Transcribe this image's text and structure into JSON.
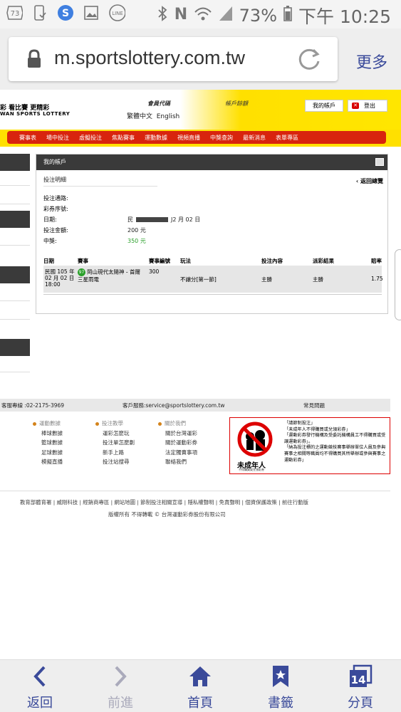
{
  "status_bar": {
    "badge": "73",
    "battery": "73%",
    "time": "下午 10:25"
  },
  "browser": {
    "url": "m.sportslottery.com.tw",
    "more_label": "更多"
  },
  "site_header": {
    "logo_zh": "彩  看比賽  更精彩",
    "logo_en": "WAN SPORTS LOTTERY",
    "member_code": "會員代碼",
    "account_pwd": "帳戶餘額",
    "lang_zh": "繁體中文",
    "lang_en": "English",
    "my_account": "我的帳戶",
    "logout": "登出"
  },
  "nav": [
    "賽事表",
    "場中投注",
    "虛擬投注",
    "焦點賽事",
    "運動數據",
    "視頻直播",
    "中獎查詢",
    "最新消息",
    "表單專區"
  ],
  "panel": {
    "title": "我的帳戶",
    "section": "投注明細",
    "back": "‹ 返回總覽",
    "fields": [
      {
        "label": "投注通路:",
        "value": ""
      },
      {
        "label": "彩券序號:",
        "value": ""
      },
      {
        "label": "日期:",
        "value_prefix": "民",
        "value": "J2 月 02 日"
      },
      {
        "label": "投注金額:",
        "value": "200 元"
      },
      {
        "label": "中獎:",
        "value": "350 元"
      }
    ],
    "headers": [
      "日期",
      "賽事",
      "賽事編號",
      "玩法",
      "投注內容",
      "派彩結果",
      "賠率"
    ],
    "row": {
      "date1": "民國 105 年",
      "date2": "02 月 02 日",
      "date3": "18:00",
      "badge": "97",
      "match1": "岡山現代太陽神 - 首爾",
      "match2": "三星雨電",
      "match_no": "300",
      "play": "不讓分[第一節]",
      "content": "主勝",
      "result": "主勝",
      "odds": "1.75"
    }
  },
  "footer": {
    "hotline": "客服專線 :02-2175-3969",
    "service": "客戶服務:service@sportslottery.com.tw",
    "faq": "常見問題",
    "col1_head": "運動數據",
    "col1": [
      "棒球數據",
      "籃球數據",
      "足球數據",
      "模擬直播"
    ],
    "col2_head": "投注教學",
    "col2": [
      "運彩怎麼玩",
      "投注單怎麼劃",
      "新手上路",
      "投注站搜尋"
    ],
    "col3_head": "關於我們",
    "col3": [
      "關於台灣運彩",
      "關於運動彩券",
      "法定獨賣事項",
      "聯絡我們"
    ],
    "warn_label": "未成年人",
    "warn_sub": "不得購買或兌領彩券",
    "warn_lines": [
      "「請節制投注」",
      "「未成年人不得購買或兌領彩券」",
      "「運動彩券發行機構及受委託機構員工不得購買或受讓運動彩券」。",
      "「納為投注標的之運動競技賽事舉辦單位人員及參與賽事之相關等職員均不得購買其所舉辦或參與賽事之運動彩券」"
    ],
    "links": "教育部體育署 | 威剛科技 | 經銷商專區 | 網站地圖 | 節制投注相關宣導 | 隱私權聲明 | 免責聲明 | 個資保護政策 | 前往行動版",
    "copyright": "版權所有 不得轉載 © 台灣運動彩券股份有限公司"
  },
  "bottom_nav": {
    "back": "返回",
    "forward": "前進",
    "home": "首頁",
    "bookmarks": "書籤",
    "tabs": "分頁",
    "tab_count": "14"
  }
}
